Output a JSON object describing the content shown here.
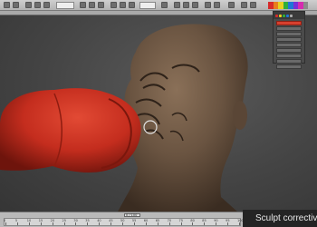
{
  "caption": {
    "text": "Sculpt corrective"
  },
  "timeline": {
    "slider_label": "0 / 100",
    "ticks": [
      "0",
      "5",
      "10",
      "15",
      "20",
      "25",
      "30",
      "35",
      "40",
      "45",
      "50",
      "55",
      "60",
      "65",
      "70",
      "75",
      "80",
      "85",
      "90",
      "95",
      "100"
    ]
  },
  "command_panel": {
    "button_count": 8
  },
  "toolbar": {
    "swatch_colors": [
      "#d62b2b",
      "#e87d1f",
      "#e8d11f",
      "#2fae3a",
      "#1f76d6",
      "#7a2fd6",
      "#d62bb0",
      "#8a8a8a"
    ]
  },
  "colors": {
    "glove": "#c42d1e",
    "skin": "#6a5441",
    "background": "#444444"
  }
}
